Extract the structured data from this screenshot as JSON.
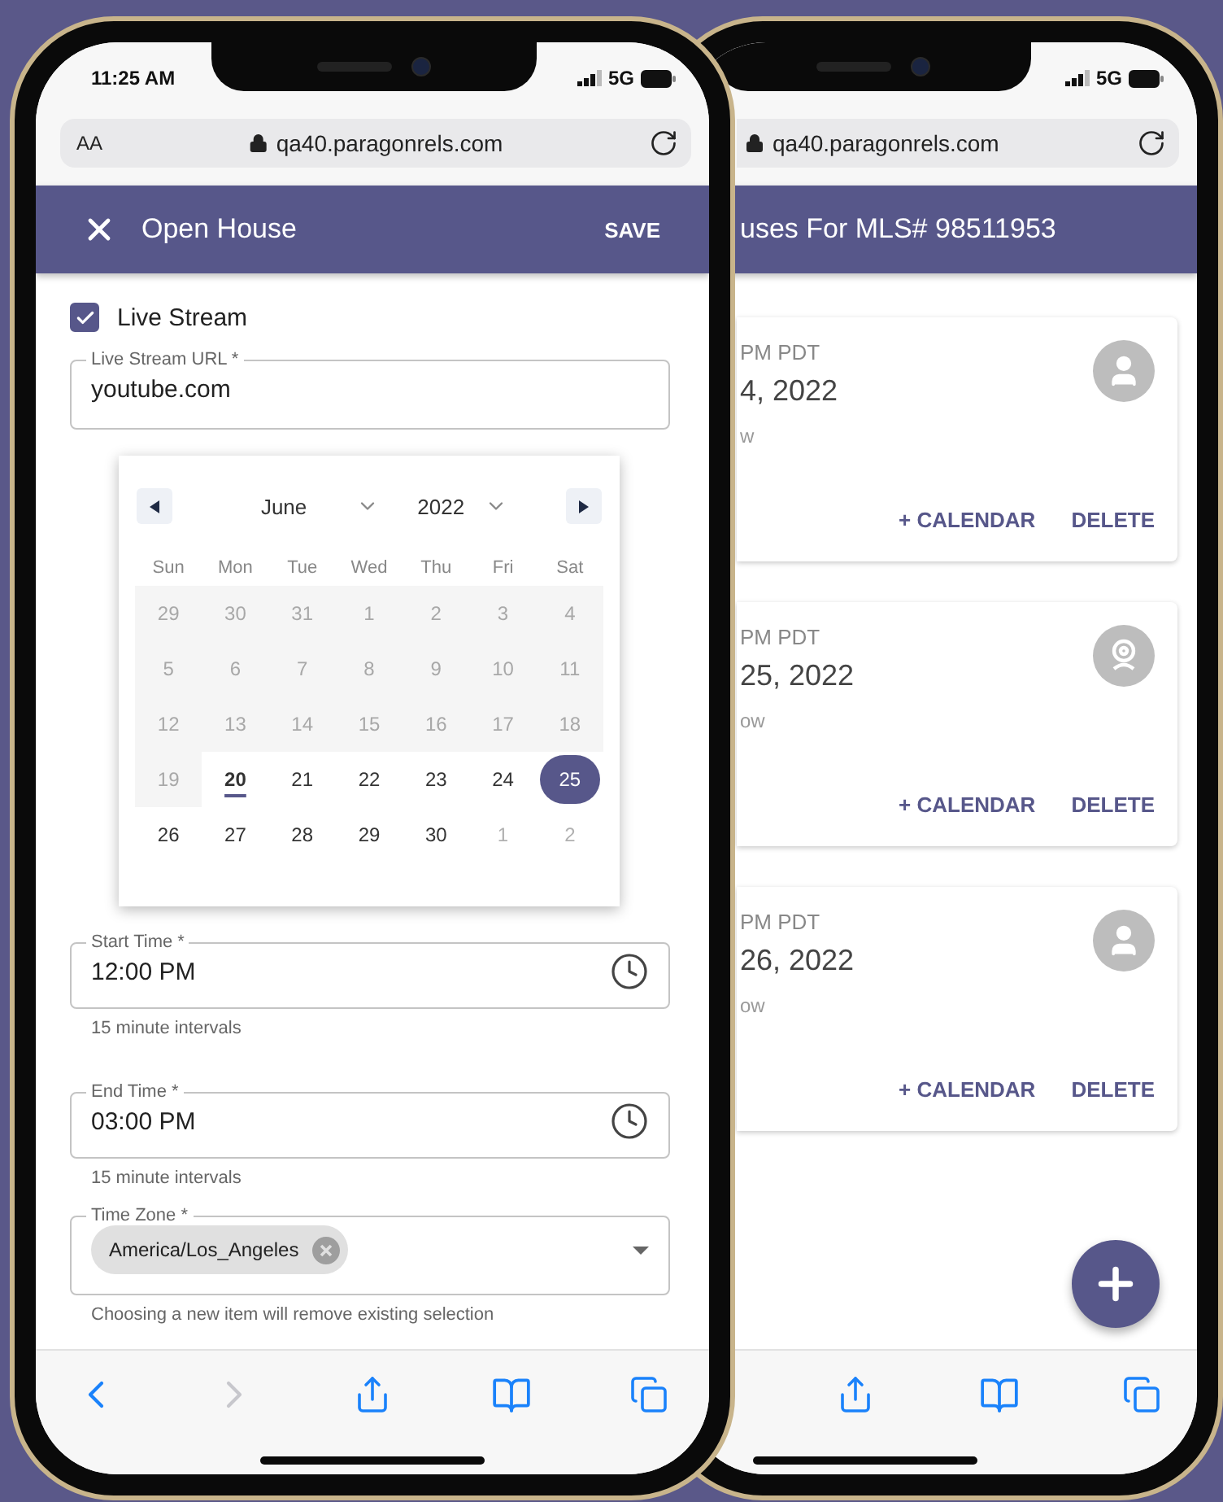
{
  "front_phone": {
    "status": {
      "time": "11:25 AM",
      "network": "5G"
    },
    "browser": {
      "text_size": "AA",
      "url": "qa40.paragonrels.com"
    },
    "app_bar": {
      "title": "Open House",
      "action": "SAVE"
    },
    "live_stream": {
      "label": "Live Stream",
      "checked": true
    },
    "url_field": {
      "label": "Live Stream URL *",
      "value": "youtube.com"
    },
    "calendar": {
      "month": "June",
      "year": "2022",
      "weekdays": [
        "Sun",
        "Mon",
        "Tue",
        "Wed",
        "Thu",
        "Fri",
        "Sat"
      ],
      "weeks": [
        [
          {
            "day": "29",
            "kind": "disabled",
            "selected": false,
            "today": false
          },
          {
            "day": "30",
            "kind": "disabled",
            "selected": false,
            "today": false
          },
          {
            "day": "31",
            "kind": "disabled",
            "selected": false,
            "today": false
          },
          {
            "day": "1",
            "kind": "disabled",
            "selected": false,
            "today": false
          },
          {
            "day": "2",
            "kind": "disabled",
            "selected": false,
            "today": false
          },
          {
            "day": "3",
            "kind": "disabled",
            "selected": false,
            "today": false
          },
          {
            "day": "4",
            "kind": "disabled",
            "selected": false,
            "today": false
          }
        ],
        [
          {
            "day": "5",
            "kind": "disabled",
            "selected": false,
            "today": false
          },
          {
            "day": "6",
            "kind": "disabled",
            "selected": false,
            "today": false
          },
          {
            "day": "7",
            "kind": "disabled",
            "selected": false,
            "today": false
          },
          {
            "day": "8",
            "kind": "disabled",
            "selected": false,
            "today": false
          },
          {
            "day": "9",
            "kind": "disabled",
            "selected": false,
            "today": false
          },
          {
            "day": "10",
            "kind": "disabled",
            "selected": false,
            "today": false
          },
          {
            "day": "11",
            "kind": "disabled",
            "selected": false,
            "today": false
          }
        ],
        [
          {
            "day": "12",
            "kind": "disabled",
            "selected": false,
            "today": false
          },
          {
            "day": "13",
            "kind": "disabled",
            "selected": false,
            "today": false
          },
          {
            "day": "14",
            "kind": "disabled",
            "selected": false,
            "today": false
          },
          {
            "day": "15",
            "kind": "disabled",
            "selected": false,
            "today": false
          },
          {
            "day": "16",
            "kind": "disabled",
            "selected": false,
            "today": false
          },
          {
            "day": "17",
            "kind": "disabled",
            "selected": false,
            "today": false
          },
          {
            "day": "18",
            "kind": "disabled",
            "selected": false,
            "today": false
          }
        ],
        [
          {
            "day": "19",
            "kind": "disabled",
            "selected": false,
            "today": false
          },
          {
            "day": "20",
            "kind": "normal",
            "selected": false,
            "today": true
          },
          {
            "day": "21",
            "kind": "normal",
            "selected": false,
            "today": false
          },
          {
            "day": "22",
            "kind": "normal",
            "selected": false,
            "today": false
          },
          {
            "day": "23",
            "kind": "normal",
            "selected": false,
            "today": false
          },
          {
            "day": "24",
            "kind": "normal",
            "selected": false,
            "today": false
          },
          {
            "day": "25",
            "kind": "normal",
            "selected": true,
            "today": false
          }
        ],
        [
          {
            "day": "26",
            "kind": "normal",
            "selected": false,
            "today": false
          },
          {
            "day": "27",
            "kind": "normal",
            "selected": false,
            "today": false
          },
          {
            "day": "28",
            "kind": "normal",
            "selected": false,
            "today": false
          },
          {
            "day": "29",
            "kind": "normal",
            "selected": false,
            "today": false
          },
          {
            "day": "30",
            "kind": "normal",
            "selected": false,
            "today": false
          },
          {
            "day": "1",
            "kind": "outside",
            "selected": false,
            "today": false
          },
          {
            "day": "2",
            "kind": "outside",
            "selected": false,
            "today": false
          }
        ]
      ]
    },
    "start_time": {
      "label": "Start Time *",
      "value": "12:00 PM",
      "helper": "15 minute intervals"
    },
    "end_time": {
      "label": "End Time *",
      "value": "03:00 PM",
      "helper": "15 minute intervals"
    },
    "time_zone": {
      "label": "Time Zone *",
      "chip": "America/Los_Angeles",
      "helper": "Choosing a new item will remove existing selection"
    },
    "toolbar": [
      {
        "kind": "back",
        "disabled": false
      },
      {
        "kind": "forward",
        "disabled": true
      },
      {
        "kind": "share",
        "disabled": false
      },
      {
        "kind": "bookmarks",
        "disabled": false
      },
      {
        "kind": "tabs",
        "disabled": false
      }
    ]
  },
  "back_phone": {
    "status": {
      "network": "5G"
    },
    "browser": {
      "url": "qa40.paragonrels.com"
    },
    "app_bar": {
      "title": "uses For MLS# 98511953"
    },
    "cards": [
      {
        "kind": "person",
        "time": "PM PDT",
        "date": "4, 2022",
        "note": "w",
        "actions": [
          "+ CALENDAR",
          "DELETE"
        ]
      },
      {
        "kind": "webcam",
        "time": "PM PDT",
        "date": "25, 2022",
        "note": "ow",
        "actions": [
          "+ CALENDAR",
          "DELETE"
        ]
      },
      {
        "kind": "person",
        "time": "PM PDT",
        "date": "26, 2022",
        "note": "ow",
        "actions": [
          "+ CALENDAR",
          "DELETE"
        ]
      }
    ],
    "toolbar": [
      {
        "kind": "share",
        "disabled": false
      },
      {
        "kind": "bookmarks",
        "disabled": false
      },
      {
        "kind": "tabs",
        "disabled": false
      }
    ]
  }
}
